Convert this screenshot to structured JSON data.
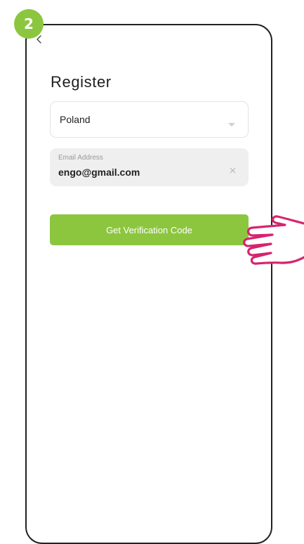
{
  "step_badge": "2",
  "screen": {
    "title": "Register",
    "back_icon": "chevron-left-icon"
  },
  "region_select": {
    "selected": "Poland",
    "icon": "chevron-down-icon"
  },
  "email_field": {
    "label": "Email Address",
    "value": "engo@gmail.com",
    "clear_icon": "close-icon"
  },
  "get_code_button": {
    "label": "Get Verification Code"
  },
  "annotation": {
    "icon": "pointing-hand-icon"
  },
  "colors": {
    "accent_green": "#8cc63f",
    "hand_magenta": "#d6246e",
    "field_fill": "#efefef",
    "frame_stroke": "#222222"
  }
}
